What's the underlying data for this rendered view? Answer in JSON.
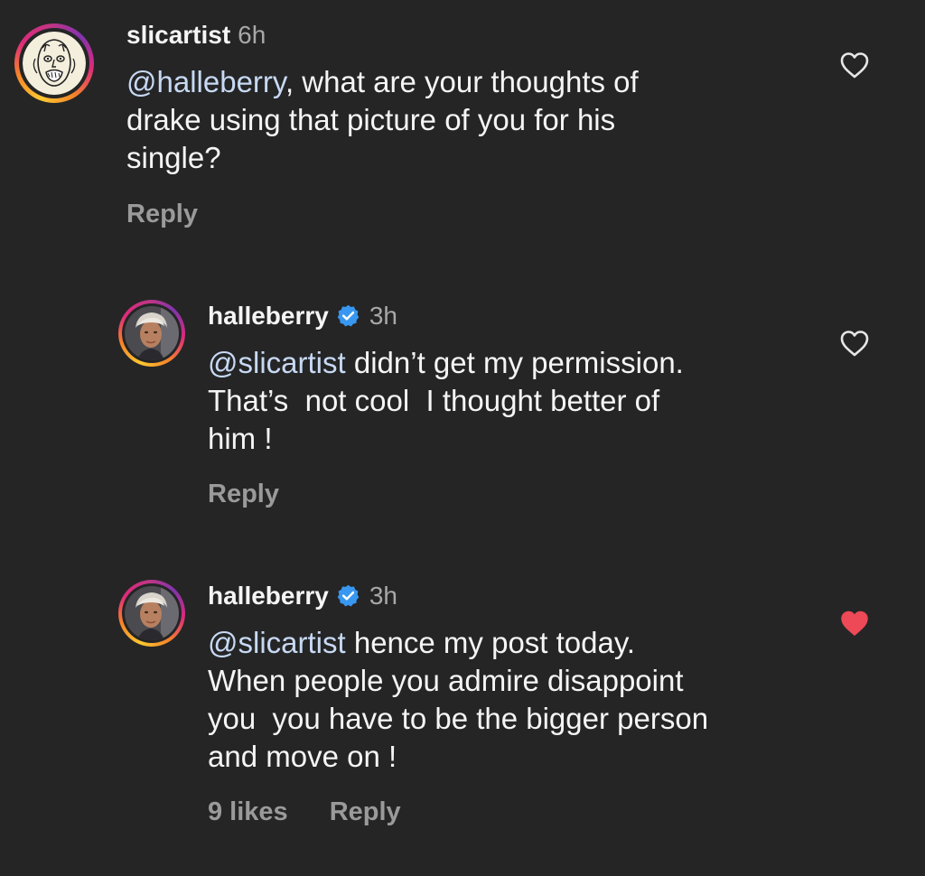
{
  "comments": [
    {
      "username": "slicartist",
      "time": "6h",
      "mention": "@halleberry",
      "text_after_mention": ", what are your thoughts of\ndrake using that picture of you for his\nsingle?",
      "verified": false,
      "likes_label": "",
      "reply_label": "Reply",
      "liked": false,
      "avatar": "cartoon-sketch-avatar"
    },
    {
      "username": "halleberry",
      "time": "3h",
      "mention": "@slicartist",
      "text_after_mention": " didn’t get my permission.\nThat’s  not cool  I thought better of\nhim !",
      "verified": true,
      "likes_label": "",
      "reply_label": "Reply",
      "liked": false,
      "avatar": "photo-avatar"
    },
    {
      "username": "halleberry",
      "time": "3h",
      "mention": "@slicartist",
      "text_after_mention": " hence my post today.\nWhen people you admire disappoint\nyou  you have to be the bigger person\nand move on !",
      "verified": true,
      "likes_label": "9 likes",
      "reply_label": "Reply",
      "liked": true,
      "avatar": "photo-avatar"
    }
  ],
  "colors": {
    "background": "#252526",
    "text": "#f5f5f5",
    "mention": "#c7d9f3",
    "muted": "#a8a8a8",
    "verified": "#3897f0",
    "liked_heart": "#ed4956"
  },
  "icons": {
    "like": "heart-outline-icon",
    "liked": "heart-filled-icon",
    "verified": "verified-badge-icon"
  }
}
